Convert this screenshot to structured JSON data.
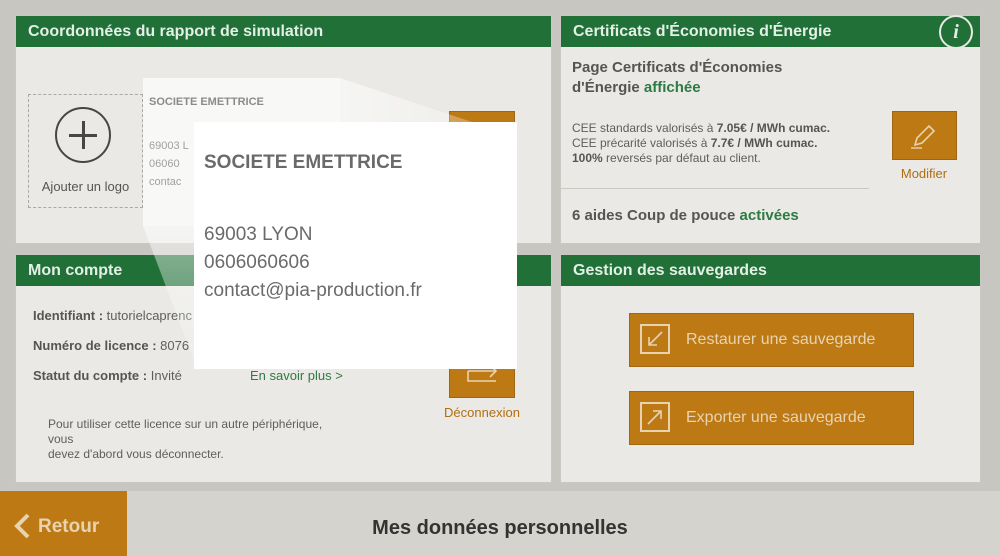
{
  "panels": {
    "simulation": {
      "title": "Coordonnées du rapport de simulation",
      "add_logo": "Ajouter un logo",
      "thumb_company": "SOCIETE EMETTRICE",
      "thumb_lines": [
        "69003 L",
        "06060",
        "contac"
      ]
    },
    "cee": {
      "title": "Certificats d'Économies d'Énergie",
      "page_line1": "Page Certificats d'Économies",
      "page_line2": "d'Énergie",
      "page_status": "affichée",
      "std_prefix": "CEE standards valorisés à ",
      "std_value": "7.05€ / MWh cumac.",
      "prec_prefix": "CEE précarité valorisés à ",
      "prec_value": "7.7€ / MWh cumac.",
      "reverse_bold": "100%",
      "reverse_rest": " reversés par défaut au client.",
      "aides_label": "6 aides Coup de pouce",
      "aides_status": "activées",
      "modify_label": "Modifier"
    },
    "account": {
      "title": "Mon compte",
      "id_label": "Identifiant :",
      "id_value": "tutorielcaprenc",
      "license_label": "Numéro de licence :",
      "license_value": "8076",
      "status_label": "Statut du compte :",
      "status_value": "Invité",
      "more_link": "En savoir plus >",
      "logout_label": "Déconnexion",
      "note_line1": "Pour utiliser cette licence sur un autre périphérique,",
      "note_line2": "vous",
      "note_line3": "devez d'abord vous déconnecter."
    },
    "backups": {
      "title": "Gestion des sauvegardes",
      "restore": "Restaurer une sauvegarde",
      "export": "Exporter une sauvegarde"
    }
  },
  "zoom_card": {
    "company": "SOCIETE EMETTRICE",
    "city": "69003 LYON",
    "phone": "0606060606",
    "email": "contact@pia-production.fr"
  },
  "footer": {
    "back_label": "Retour",
    "page_title": "Mes données personnelles"
  },
  "info_icon_glyph": "i"
}
